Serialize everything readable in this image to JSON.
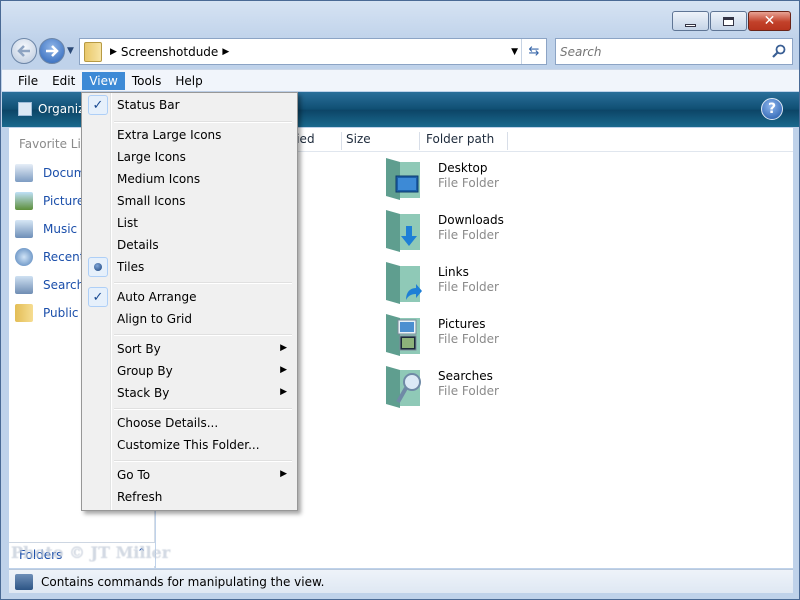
{
  "window": {
    "caption_buttons": [
      "minimize",
      "maximize",
      "close"
    ]
  },
  "navigation": {
    "address_path": "Screenshotdude",
    "search_placeholder": "Search"
  },
  "menubar": {
    "items": [
      {
        "label": "File"
      },
      {
        "label": "Edit"
      },
      {
        "label": "View",
        "active": true
      },
      {
        "label": "Tools"
      },
      {
        "label": "Help"
      }
    ]
  },
  "toolbar": {
    "organize_label": "Organiz"
  },
  "nav_pane": {
    "title": "Favorite Lin",
    "items": [
      {
        "label": "Docum",
        "icon": "documents-icon"
      },
      {
        "label": "Picture",
        "icon": "pictures-icon"
      },
      {
        "label": "Music",
        "icon": "music-icon"
      },
      {
        "label": "Recent",
        "icon": "recent-icon"
      },
      {
        "label": "Search",
        "icon": "searches-icon"
      },
      {
        "label": "Public",
        "icon": "folder-icon"
      }
    ],
    "folders_label": "Folders"
  },
  "columns": [
    {
      "label": "fied"
    },
    {
      "label": "Size"
    },
    {
      "label": "Folder path"
    }
  ],
  "files": [
    {
      "name": "Desktop",
      "type": "File Folder",
      "icon": "desktop-folder-icon"
    },
    {
      "name": "Downloads",
      "type": "File Folder",
      "icon": "downloads-folder-icon"
    },
    {
      "name": "Links",
      "type": "File Folder",
      "icon": "links-folder-icon"
    },
    {
      "name": "Pictures",
      "type": "File Folder",
      "icon": "pictures-folder-icon"
    },
    {
      "name": "Searches",
      "type": "File Folder",
      "icon": "searches-folder-icon"
    }
  ],
  "view_menu": {
    "items": [
      {
        "label": "Status Bar",
        "mark": "check"
      },
      {
        "label": "Extra Large Icons"
      },
      {
        "label": "Large Icons"
      },
      {
        "label": "Medium Icons"
      },
      {
        "label": "Small Icons"
      },
      {
        "label": "List"
      },
      {
        "label": "Details"
      },
      {
        "label": "Tiles",
        "mark": "radio"
      },
      {
        "label": "Auto Arrange",
        "mark": "check"
      },
      {
        "label": "Align to Grid"
      },
      {
        "label": "Sort By",
        "submenu": true
      },
      {
        "label": "Group By",
        "submenu": true
      },
      {
        "label": "Stack By",
        "submenu": true
      },
      {
        "label": "Choose Details..."
      },
      {
        "label": "Customize This Folder..."
      },
      {
        "label": "Go To",
        "submenu": true
      },
      {
        "label": "Refresh"
      }
    ]
  },
  "status_bar": {
    "text": "Contains commands for manipulating the view."
  },
  "watermark": "Photo © JT Miller",
  "colors": {
    "accent": "#3d8ad6",
    "link": "#1a4eaa",
    "toolbar": "#0f4e72",
    "close": "#c2412a"
  }
}
